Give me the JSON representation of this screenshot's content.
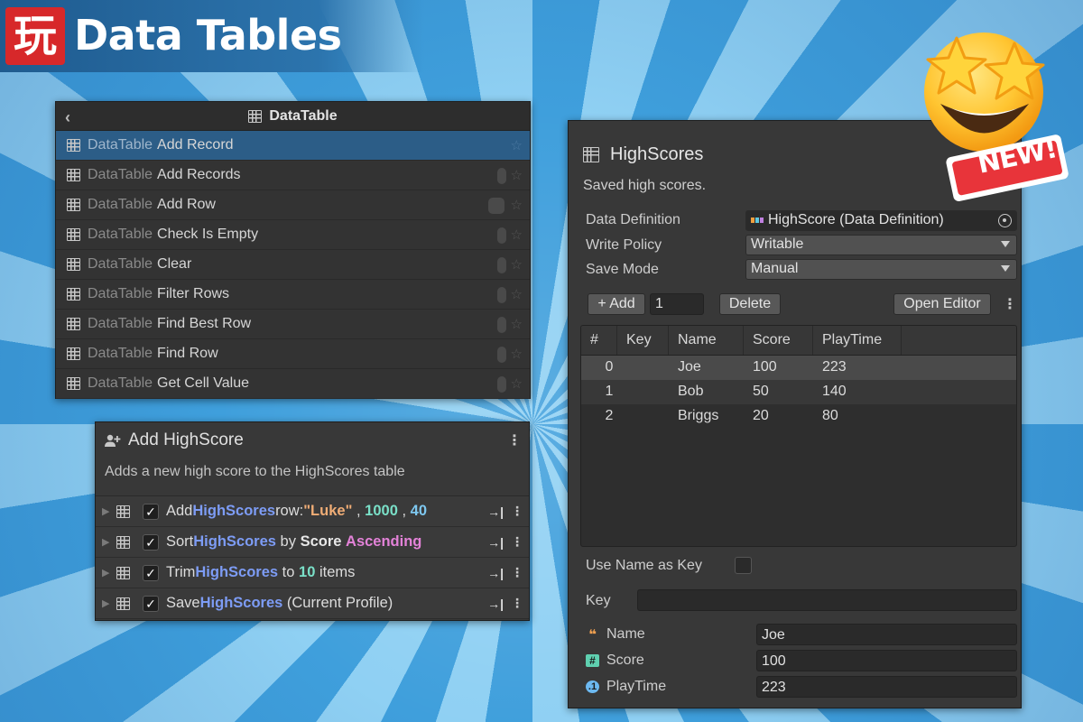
{
  "banner": {
    "logo_glyph": "玩",
    "title": "Data Tables"
  },
  "datatable_list": {
    "header": "DataTable",
    "items": [
      {
        "prefix": "DataTable",
        "label": "Add Record",
        "selected": true
      },
      {
        "prefix": "DataTable",
        "label": "Add Records"
      },
      {
        "prefix": "DataTable",
        "label": "Add Row"
      },
      {
        "prefix": "DataTable",
        "label": "Check Is Empty"
      },
      {
        "prefix": "DataTable",
        "label": "Clear"
      },
      {
        "prefix": "DataTable",
        "label": "Filter Rows"
      },
      {
        "prefix": "DataTable",
        "label": "Find Best Row"
      },
      {
        "prefix": "DataTable",
        "label": "Find Row"
      },
      {
        "prefix": "DataTable",
        "label": "Get Cell Value"
      }
    ]
  },
  "action": {
    "title": "Add HighScore",
    "description": "Adds a new high score to the HighScores table",
    "rows": [
      {
        "parts": [
          "Add ",
          "HighScores",
          " row: ",
          "\"Luke\"",
          " , ",
          "1000",
          " , ",
          "40"
        ]
      },
      {
        "parts": [
          "Sort ",
          "HighScores",
          " by ",
          "Score",
          " ",
          "Ascending"
        ]
      },
      {
        "parts": [
          "Trim ",
          "HighScores",
          " to ",
          "10",
          " items"
        ]
      },
      {
        "parts": [
          "Save ",
          "HighScores",
          " (Current Profile)"
        ]
      }
    ],
    "row_arrow": "→|"
  },
  "inspector": {
    "title": "HighScores",
    "description": "Saved high scores.",
    "data_definition_label": "Data Definition",
    "data_definition_value": "HighScore (Data Definition)",
    "write_policy_label": "Write Policy",
    "write_policy_value": "Writable",
    "save_mode_label": "Save Mode",
    "save_mode_value": "Manual",
    "add_button": "+ Add",
    "add_count": "1",
    "delete_button": "Delete",
    "open_editor_button": "Open Editor",
    "columns": [
      "#",
      "Key",
      "Name",
      "Score",
      "PlayTime"
    ],
    "rows": [
      {
        "index": "0",
        "key": "",
        "name": "Joe",
        "score": "100",
        "playtime": "223"
      },
      {
        "index": "1",
        "key": "",
        "name": "Bob",
        "score": "50",
        "playtime": "140"
      },
      {
        "index": "2",
        "key": "",
        "name": "Briggs",
        "score": "20",
        "playtime": "80"
      }
    ],
    "use_name_as_key_label": "Use Name as Key",
    "key_label": "Key",
    "name_label": "Name",
    "name_value": "Joe",
    "score_label": "Score",
    "score_value": "100",
    "playtime_label": "PlayTime",
    "playtime_value": "223"
  },
  "badge": {
    "text": "NEW!"
  }
}
